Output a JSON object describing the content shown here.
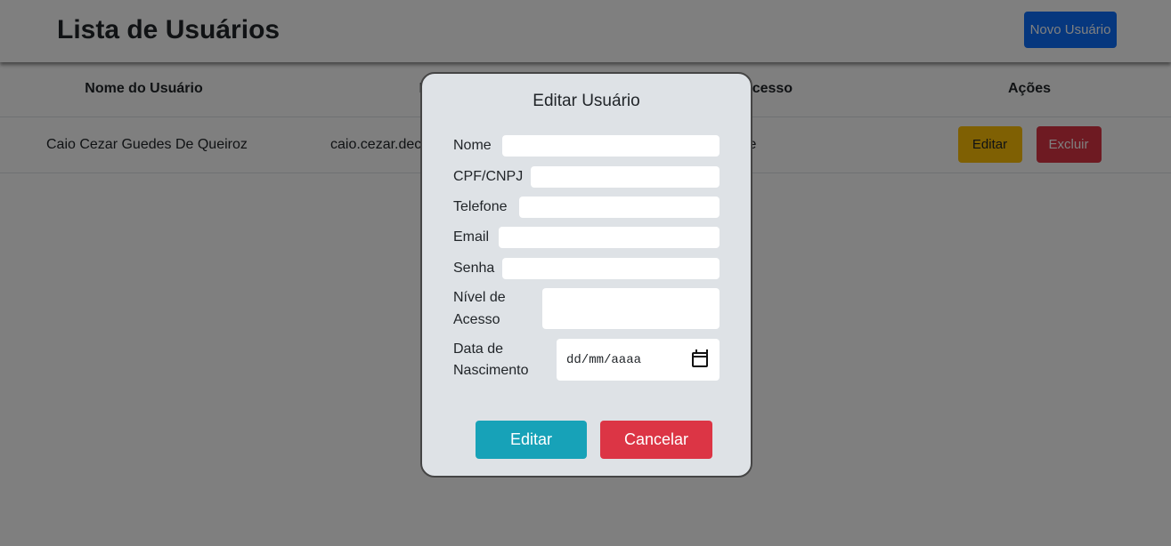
{
  "header": {
    "title": "Lista de Usuários",
    "new_user_label": "Novo Usuário"
  },
  "table": {
    "columns": [
      "Nome do Usuário",
      "Email",
      "Nível de Acesso",
      "Ações"
    ],
    "rows": [
      {
        "name": "Caio Cezar Guedes De Queiroz",
        "email": "caio.cezar.dec",
        "access_level": "e",
        "edit_label": "Editar",
        "delete_label": "Excluir"
      }
    ]
  },
  "modal": {
    "title": "Editar Usuário",
    "fields": {
      "nome": {
        "label": "Nome",
        "value": ""
      },
      "cpf": {
        "label": "CPF/CNPJ",
        "value": ""
      },
      "telefone": {
        "label": "Telefone",
        "value": ""
      },
      "email": {
        "label": "Email",
        "value": ""
      },
      "senha": {
        "label": "Senha",
        "value": ""
      },
      "nivel_line1": "Nível de",
      "nivel_line2": "Acesso",
      "nascimento_line1": "Data de",
      "nascimento_line2": "Nascimento",
      "date_placeholder": "dd/mm/aaaa"
    },
    "edit_label": "Editar",
    "cancel_label": "Cancelar"
  },
  "colors": {
    "primary": "#0d6efd",
    "warning": "#ffc107",
    "danger": "#dc3545",
    "info": "#17a2b8",
    "modal_bg": "#dee2e6"
  },
  "icons": {
    "date_picker": "calendar-icon"
  }
}
